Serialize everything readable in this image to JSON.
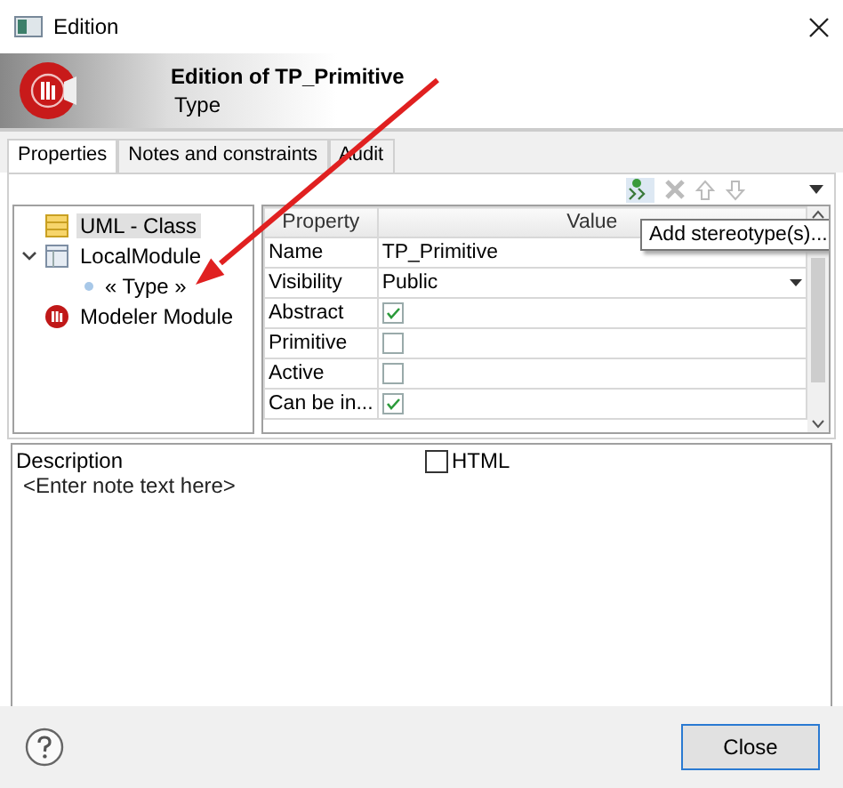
{
  "window": {
    "title": "Edition"
  },
  "header": {
    "title": "Edition of TP_Primitive",
    "subtitle": "Type"
  },
  "tabs": [
    {
      "label": "Properties",
      "selected": true
    },
    {
      "label": "Notes and constraints",
      "selected": false
    },
    {
      "label": "Audit",
      "selected": false
    }
  ],
  "tree": [
    {
      "label": "UML - Class",
      "kind": "class",
      "selected": true
    },
    {
      "label": "LocalModule",
      "kind": "module",
      "selected": false,
      "expanded": true,
      "children": [
        {
          "label": "« Type »",
          "kind": "stereotype",
          "selected": false
        }
      ]
    },
    {
      "label": "Modeler Module",
      "kind": "modeler",
      "selected": false
    }
  ],
  "table": {
    "columns": [
      "Property",
      "Value"
    ],
    "rows": [
      {
        "property": "Name",
        "kind": "text",
        "value": "TP_Primitive"
      },
      {
        "property": "Visibility",
        "kind": "dropdown",
        "value": "Public"
      },
      {
        "property": "Abstract",
        "kind": "checkbox",
        "checked": true
      },
      {
        "property": "Primitive",
        "kind": "checkbox",
        "checked": false
      },
      {
        "property": "Active",
        "kind": "checkbox",
        "checked": false
      },
      {
        "property": "Can be in...",
        "kind": "checkbox",
        "checked": true
      }
    ]
  },
  "tooltip": "Add stereotype(s)...",
  "description": {
    "label": "Description",
    "placeholder": "<Enter note text here>",
    "html": {
      "label": "HTML",
      "checked": false
    }
  },
  "buttons": {
    "close": "Close"
  }
}
